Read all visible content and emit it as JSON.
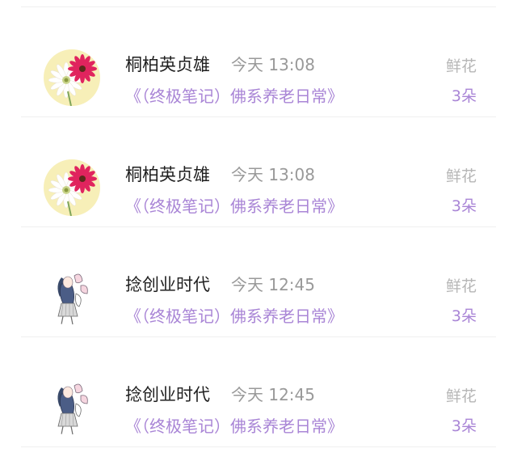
{
  "gifts": [
    {
      "user": "桐柏英贞雄",
      "time": "今天 13:08",
      "title": "《（终极笔记）佛系养老日常》",
      "gift_type": "鲜花",
      "gift_count": "3朵",
      "avatar": "flower-avatar"
    },
    {
      "user": "桐柏英贞雄",
      "time": "今天 13:08",
      "title": "《（终极笔记）佛系养老日常》",
      "gift_type": "鲜花",
      "gift_count": "3朵",
      "avatar": "flower-avatar"
    },
    {
      "user": "捻创业时代",
      "time": "今天 12:45",
      "title": "《（终极笔记）佛系养老日常》",
      "gift_type": "鲜花",
      "gift_count": "3朵",
      "avatar": "anime-girl-avatar"
    },
    {
      "user": "捻创业时代",
      "time": "今天 12:45",
      "title": "《（终极笔记）佛系养老日常》",
      "gift_type": "鲜花",
      "gift_count": "3朵",
      "avatar": "anime-girl-avatar"
    }
  ],
  "colors": {
    "accent": "#a985d6",
    "name": "#1f1f1f",
    "muted": "#999999",
    "divider": "#f0f0f0"
  }
}
